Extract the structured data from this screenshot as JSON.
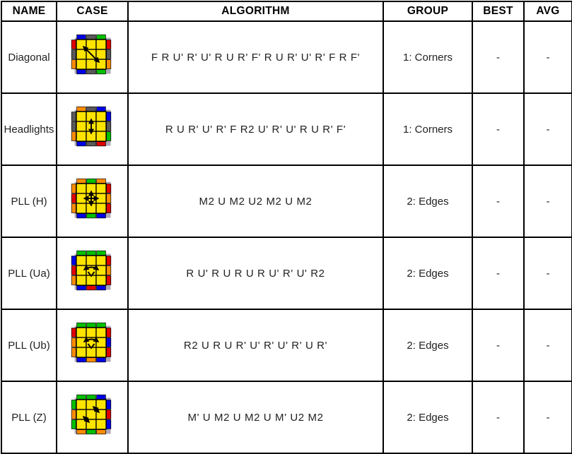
{
  "table": {
    "columns": [
      {
        "key": "name",
        "label": "NAME"
      },
      {
        "key": "case",
        "label": "CASE"
      },
      {
        "key": "alg",
        "label": "ALGORITHM"
      },
      {
        "key": "group",
        "label": "GROUP"
      },
      {
        "key": "best",
        "label": "BEST"
      },
      {
        "key": "avg",
        "label": "AVG"
      }
    ],
    "rows": [
      {
        "name": "Diagonal",
        "case_icon": "rubiks-cube-oll-diagonal",
        "alg": "F R U' R' U' R U R' F' R U R' U' R' F R F'",
        "group": "1: Corners",
        "best": "-",
        "avg": "-"
      },
      {
        "name": "Headlights",
        "case_icon": "rubiks-cube-oll-headlights",
        "alg": "R U R' U' R' F R2 U' R' U' R U R' F'",
        "group": "1: Corners",
        "best": "-",
        "avg": "-"
      },
      {
        "name": "PLL (H)",
        "case_icon": "rubiks-cube-pll-h",
        "alg": "M2 U M2 U2 M2 U M2",
        "group": "2: Edges",
        "best": "-",
        "avg": "-"
      },
      {
        "name": "PLL (Ua)",
        "case_icon": "rubiks-cube-pll-ua",
        "alg": "R U' R U R U R U' R' U' R2",
        "group": "2: Edges",
        "best": "-",
        "avg": "-"
      },
      {
        "name": "PLL (Ub)",
        "case_icon": "rubiks-cube-pll-ub",
        "alg": "R2 U R U R' U' R' U' R' U R'",
        "group": "2: Edges",
        "best": "-",
        "avg": "-"
      },
      {
        "name": "PLL (Z)",
        "case_icon": "rubiks-cube-pll-z",
        "alg": "M' U M2 U M2 U M' U2 M2",
        "group": "2: Edges",
        "best": "-",
        "avg": "-"
      }
    ]
  },
  "colors": {
    "grid_line": "#000000",
    "background": "#ffffff",
    "text": "#222222",
    "header_text": "#000000",
    "cube_yellow": "#ffe400",
    "cube_red": "#e00000",
    "cube_green": "#00c000",
    "cube_blue": "#0000e6",
    "cube_orange": "#ff8c00",
    "cube_gray": "#595959",
    "cube_outline": "#000000",
    "cube_border": "#b0a8b8"
  },
  "cubes": {
    "rubiks-cube-oll-diagonal": {
      "top": [
        "blue",
        "gray",
        "green"
      ],
      "left": [
        "red",
        "gray",
        "orange"
      ],
      "right": [
        "red",
        "gray",
        "orange"
      ],
      "bottom": [
        "blue",
        "gray",
        "green"
      ],
      "arrows": [
        {
          "type": "double-diagonal",
          "from": [
            0,
            0
          ],
          "to": [
            2,
            2
          ]
        }
      ]
    },
    "rubiks-cube-oll-headlights": {
      "top": [
        "orange",
        "gray",
        "blue"
      ],
      "left": [
        "gray",
        "gray",
        "orange"
      ],
      "right": [
        "blue",
        "gray",
        "green"
      ],
      "bottom": [
        "blue",
        "gray",
        "red"
      ],
      "arrows": [
        {
          "type": "double-vertical",
          "from": [
            1,
            0
          ],
          "to": [
            1,
            2
          ]
        }
      ]
    },
    "rubiks-cube-pll-h": {
      "top": [
        "orange",
        "green",
        "orange"
      ],
      "left": [
        "orange",
        "red",
        "orange"
      ],
      "right": [
        "red",
        "orange",
        "red"
      ],
      "bottom": [
        "blue",
        "green",
        "blue"
      ],
      "arrows": [
        {
          "type": "double-vertical",
          "from": [
            1,
            0
          ],
          "to": [
            1,
            2
          ]
        },
        {
          "type": "double-horizontal",
          "from": [
            0,
            1
          ],
          "to": [
            2,
            1
          ]
        }
      ]
    },
    "rubiks-cube-pll-ua": {
      "top": [
        "green",
        "green",
        "green"
      ],
      "left": [
        "blue",
        "red",
        "orange"
      ],
      "right": [
        "red",
        "orange",
        "red"
      ],
      "bottom": [
        "blue",
        "red",
        "blue"
      ],
      "arrows": [
        {
          "type": "three-cycle-top"
        }
      ]
    },
    "rubiks-cube-pll-ub": {
      "top": [
        "green",
        "green",
        "green"
      ],
      "left": [
        "red",
        "orange",
        "orange"
      ],
      "right": [
        "red",
        "blue",
        "red"
      ],
      "bottom": [
        "blue",
        "orange",
        "blue"
      ],
      "arrows": [
        {
          "type": "three-cycle-top"
        }
      ]
    },
    "rubiks-cube-pll-z": {
      "top": [
        "green",
        "green",
        "blue"
      ],
      "left": [
        "green",
        "orange",
        "green"
      ],
      "right": [
        "blue",
        "red",
        "blue"
      ],
      "bottom": [
        "orange",
        "green",
        "orange"
      ],
      "arrows": [
        {
          "type": "double-diagonal-down",
          "from": [
            1,
            0
          ],
          "to": [
            2,
            1
          ]
        },
        {
          "type": "double-diagonal-down",
          "from": [
            0,
            1
          ],
          "to": [
            1,
            2
          ]
        }
      ]
    }
  }
}
